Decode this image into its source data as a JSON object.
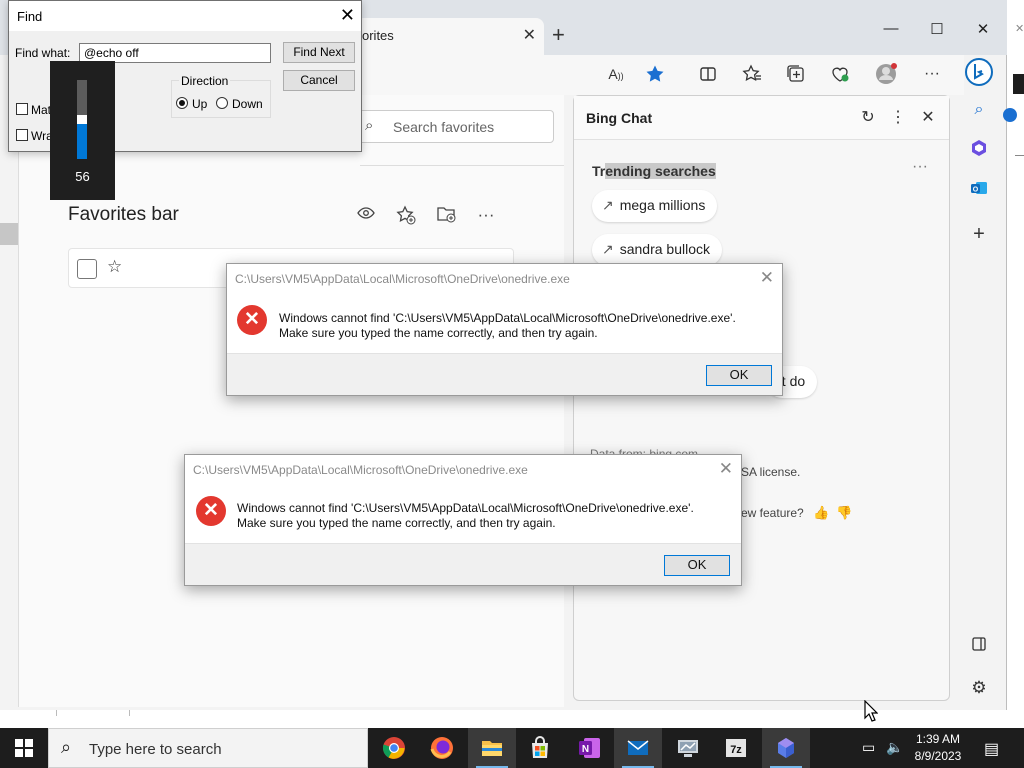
{
  "browser": {
    "tab_title": "orites",
    "tab_close": "✕",
    "new_tab": "+",
    "window_controls": {
      "minimize": "—",
      "maximize": "☐",
      "close": "✕"
    },
    "toolbar_icons": [
      "read-aloud-icon",
      "favorite-star-icon",
      "split-screen-icon",
      "favorites-list-icon",
      "collections-icon",
      "browser-essentials-icon",
      "profile-icon",
      "more-icon"
    ]
  },
  "favorites": {
    "search_placeholder": "Search favorites",
    "section_title": "Favorites bar"
  },
  "bing_chat": {
    "title": "Bing Chat",
    "trending_title": "Trending searches",
    "trending_title_prefix": "Tr",
    "trending_title_highlight": "ending searches",
    "chips": [
      "mega millions",
      "sandra bullock"
    ],
    "partial_chip": "at do",
    "footer_data": "Data from: bing.com",
    "license": "SA license.",
    "feedback_question": "ew feature?"
  },
  "find_dialog": {
    "title": "Find",
    "find_what_label": "Find what:",
    "find_what_value": "@echo off",
    "find_next": "Find Next",
    "cancel": "Cancel",
    "direction_label": "Direction",
    "up_label": "Up",
    "down_label": "Down",
    "direction_selected": "Up",
    "match_case_label": "Matc",
    "wrap_label": "Wra"
  },
  "volume_osd": {
    "value": "56",
    "level": 0.56
  },
  "error_dialogs": [
    {
      "title": "C:\\Users\\VM5\\AppData\\Local\\Microsoft\\OneDrive\\onedrive.exe",
      "line1": "Windows cannot find 'C:\\Users\\VM5\\AppData\\Local\\Microsoft\\OneDrive\\onedrive.exe'.",
      "line2": "Make sure you typed the name correctly, and then try again.",
      "ok": "OK"
    },
    {
      "title": "C:\\Users\\VM5\\AppData\\Local\\Microsoft\\OneDrive\\onedrive.exe",
      "line1": "Windows cannot find 'C:\\Users\\VM5\\AppData\\Local\\Microsoft\\OneDrive\\onedrive.exe'.",
      "line2": "Make sure you typed the name correctly, and then try again.",
      "ok": "OK"
    }
  ],
  "taskbar": {
    "search_placeholder": "Type here to search",
    "time": "1:39 AM",
    "date": "8/9/2023",
    "apps": [
      "chrome-icon",
      "firefox-icon",
      "file-explorer-icon",
      "microsoft-store-icon",
      "onenote-icon",
      "mail-icon",
      "network-icon",
      "7zip-icon",
      "copilot-icon"
    ]
  },
  "colors": {
    "accent": "#0078d7",
    "error": "#e3382f",
    "taskbar": "#1d1d1d",
    "favorite_star": "#1a6fd1"
  }
}
